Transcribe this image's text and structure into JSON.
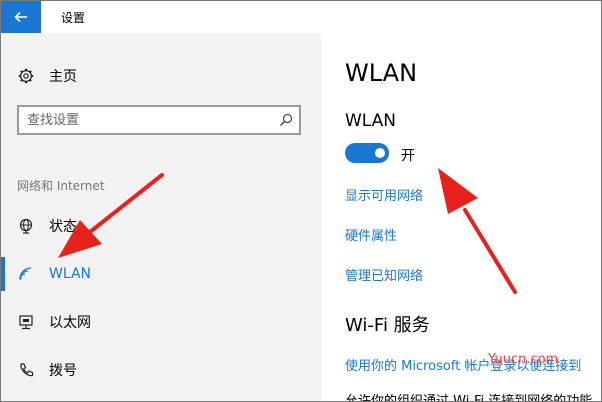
{
  "window": {
    "title": "设置"
  },
  "sidebar": {
    "home_label": "主页",
    "search_placeholder": "查找设置",
    "section_label": "网络和 Internet",
    "items": [
      {
        "label": "状态",
        "icon": "globe-icon"
      },
      {
        "label": "WLAN",
        "icon": "wifi-icon",
        "active": true
      },
      {
        "label": "以太网",
        "icon": "ethernet-icon"
      },
      {
        "label": "拨号",
        "icon": "phone-icon"
      }
    ]
  },
  "main": {
    "title": "WLAN",
    "subtitle": "WLAN",
    "toggle_state": "开",
    "links": [
      "显示可用网络",
      "硬件属性",
      "管理已知网络"
    ],
    "wifi_services_title": "Wi-Fi 服务",
    "wifi_services_link": "使用你的 Microsoft 帐户登录以便连接到",
    "cut_text": "允许你的组织通过 Wi-Fi 连接到网络的功能"
  },
  "watermark": "Yuucn.com",
  "colors": {
    "accent": "#1976d2",
    "annotation_arrow": "#e8211d",
    "watermark": "#ff3b30"
  }
}
